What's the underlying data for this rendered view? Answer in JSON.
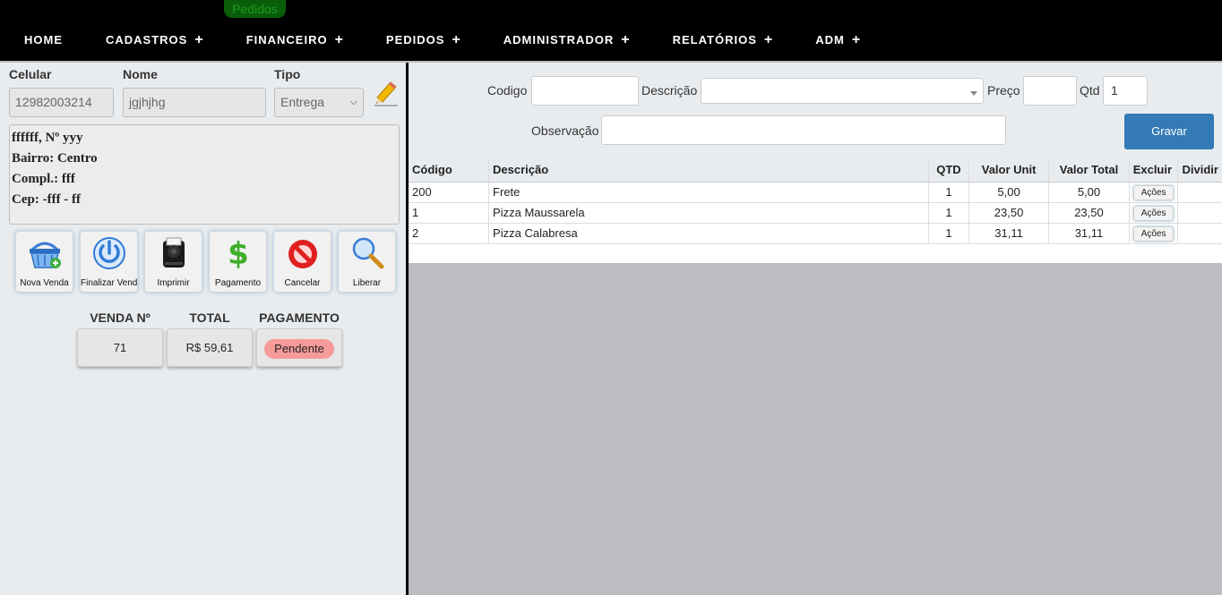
{
  "page_badge": "Pedidos",
  "nav": [
    {
      "label": "HOME",
      "has_plus": false
    },
    {
      "label": "CADASTROS",
      "has_plus": true
    },
    {
      "label": "FINANCEIRO",
      "has_plus": true
    },
    {
      "label": "PEDIDOS",
      "has_plus": true
    },
    {
      "label": "ADMINISTRADOR",
      "has_plus": true
    },
    {
      "label": "RELATÓRIOS",
      "has_plus": true
    },
    {
      "label": "ADM",
      "has_plus": true
    }
  ],
  "plus_symbol": "+",
  "customer": {
    "celular_label": "Celular",
    "celular_value": "12982003214",
    "nome_label": "Nome",
    "nome_value": "jgjhjhg",
    "tipo_label": "Tipo",
    "tipo_value": "Entrega",
    "address_lines": [
      "ffffff, Nº yyy",
      "Bairro: Centro",
      "Compl.: fff",
      "Cep: -fff - ff"
    ]
  },
  "tools": [
    {
      "label": "Nova Venda",
      "icon": "basket-add-icon"
    },
    {
      "label": "Finalizar Venda",
      "icon": "power-icon"
    },
    {
      "label": "Imprimir",
      "icon": "printer-icon"
    },
    {
      "label": "Pagamento",
      "icon": "dollar-icon"
    },
    {
      "label": "Cancelar",
      "icon": "cancel-icon"
    },
    {
      "label": "Liberar",
      "icon": "magnifier-icon"
    }
  ],
  "summary": {
    "venda_label": "VENDA Nº",
    "venda_value": "71",
    "total_label": "TOTAL",
    "total_value": "R$ 59,61",
    "pagamento_label": "PAGAMENTO",
    "pagamento_value": "Pendente"
  },
  "form": {
    "codigo_label": "Codigo",
    "codigo_value": "",
    "descricao_label": "Descrição",
    "descricao_value": "",
    "preco_label": "Preço",
    "preco_value": "",
    "qtd_label": "Qtd",
    "qtd_value": "1",
    "observacao_label": "Observação",
    "observacao_value": "",
    "gravar_label": "Gravar"
  },
  "table": {
    "headers": [
      "Código",
      "Descrição",
      "QTD",
      "Valor Unit",
      "Valor Total",
      "Excluir",
      "Dividir"
    ],
    "rows": [
      {
        "codigo": "200",
        "descricao": "Frete",
        "qtd": "1",
        "valor_unit": "5,00",
        "valor_total": "5,00",
        "acoes": "Ações"
      },
      {
        "codigo": "1",
        "descricao": "Pizza Maussarela",
        "qtd": "1",
        "valor_unit": "23,50",
        "valor_total": "23,50",
        "acoes": "Ações"
      },
      {
        "codigo": "2",
        "descricao": "Pizza Calabresa",
        "qtd": "1",
        "valor_unit": "31,11",
        "valor_total": "31,11",
        "acoes": "Ações"
      }
    ]
  },
  "colors": {
    "nav_bg": "#000000",
    "badge_bg": "#0a5e0a",
    "primary_button": "#337ab7",
    "pending_pill": "#f79a9a"
  }
}
